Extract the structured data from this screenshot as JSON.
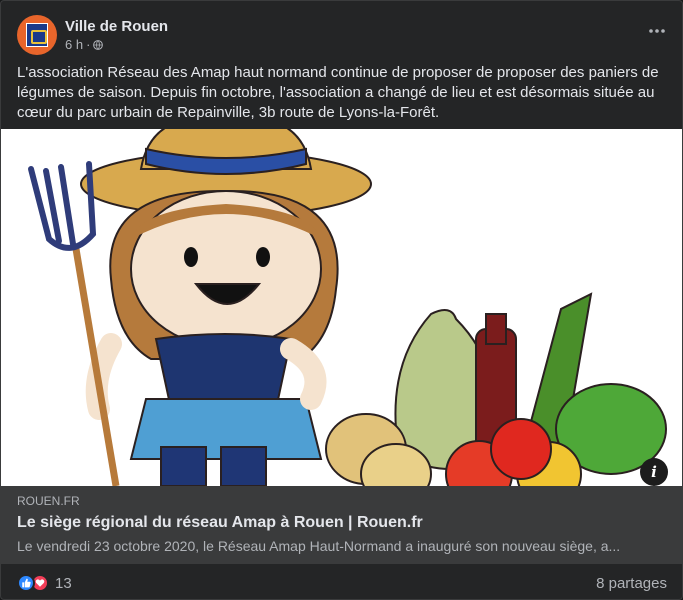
{
  "post": {
    "page_name": "Ville de Rouen",
    "time": "6 h",
    "dot": "·",
    "text": "L'association Réseau des Amap haut normand continue de proposer de proposer des paniers de légumes de saison. Depuis fin octobre, l'association a changé de lieu et est désormais située au cœur du parc urbain de Repainville, 3b route de Lyons-la-Forêt."
  },
  "image": {
    "info_label": "i"
  },
  "link": {
    "domain": "ROUEN.FR",
    "title": "Le siège régional du réseau Amap à Rouen | Rouen.fr",
    "description": "Le vendredi 23 octobre 2020, le Réseau Amap Haut-Normand a inauguré son nouveau siège, a..."
  },
  "footer": {
    "reaction_count": "13",
    "shares": "8 partages"
  },
  "icons": {
    "avatar": "rouen-crest-icon",
    "audience": "globe-icon",
    "more": "more-options-icon",
    "like": "like-reaction-icon",
    "love": "love-reaction-icon",
    "info": "info-icon"
  },
  "colors": {
    "background": "#242526",
    "link_box": "#3a3b3c",
    "primary_text": "#e4e6eb",
    "secondary_text": "#b0b3b8",
    "like_blue": "#2d88ff",
    "love_red": "#f33e58",
    "avatar_orange": "#e8652b"
  }
}
